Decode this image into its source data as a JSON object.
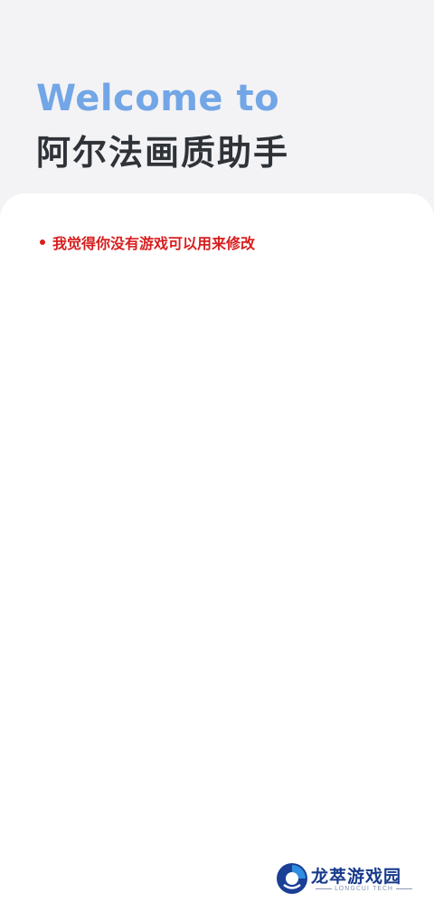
{
  "header": {
    "welcome_text": "Welcome to",
    "app_name": "阿尔法画质助手"
  },
  "notice": {
    "text": "我觉得你没有游戏可以用来修改",
    "color": "#d81e1e"
  },
  "watermark": {
    "name": "龙萃游戏园",
    "subtitle": "LONGCUI TECH"
  },
  "colors": {
    "welcome": "#72a6e6",
    "title": "#2f3338",
    "background": "#f3f3f5",
    "card": "#ffffff",
    "watermark_brand": "#173a8a"
  }
}
